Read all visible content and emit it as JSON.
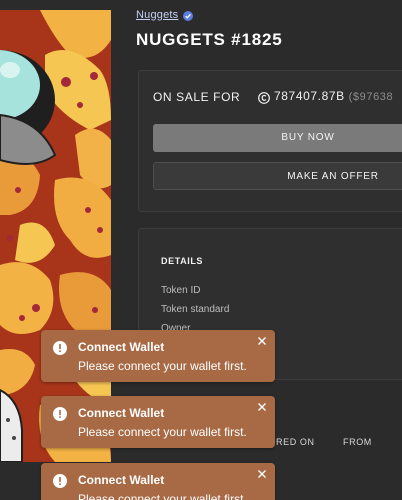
{
  "collection": {
    "name": "Nuggets",
    "verified_icon": "verified-badge-icon"
  },
  "nft": {
    "title": "NUGGETS #1825"
  },
  "sale": {
    "label": "ON SALE FOR",
    "token_icon": "cardano-token-icon",
    "price": "787407.87B",
    "price_fiat": "($97638"
  },
  "actions": {
    "buy_label": "BUY NOW",
    "offer_label": "MAKE AN OFFER"
  },
  "details": {
    "heading": "DETAILS",
    "rows": [
      "Token ID",
      "Token standard",
      "Owner"
    ]
  },
  "activity": {
    "columns": [
      "RED ON",
      "FROM"
    ]
  },
  "toasts": [
    {
      "icon": "exclamation-circle-icon",
      "title": "Connect Wallet",
      "message": "Please connect your wallet first.",
      "close_icon": "close-icon"
    },
    {
      "icon": "exclamation-circle-icon",
      "title": "Connect Wallet",
      "message": "Please connect your wallet first.",
      "close_icon": "close-icon"
    },
    {
      "icon": "exclamation-circle-icon",
      "title": "Connect Wallet",
      "message": "Please connect your wallet first.",
      "close_icon": "close-icon"
    }
  ],
  "colors": {
    "background": "#2b2b2b",
    "toast": "#a86a45",
    "link": "#c7cff5",
    "verified": "#5b7ce0",
    "artwork_base": "#a8351a"
  }
}
